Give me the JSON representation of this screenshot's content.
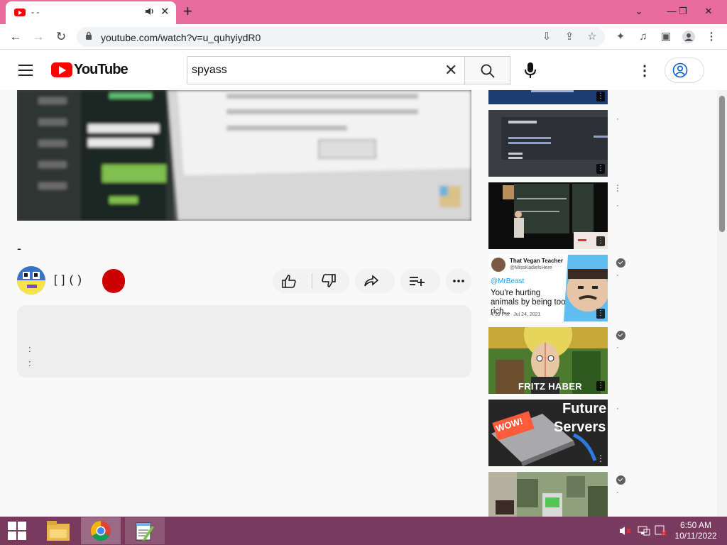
{
  "browser": {
    "tab_title": "- -",
    "url": "youtube.com/watch?v=u_quhyiydR0",
    "window_controls": [
      "chevron-down",
      "minimize",
      "restore",
      "close"
    ]
  },
  "youtube": {
    "logo_text": "YouTube",
    "search_value": "spyass",
    "video": {
      "title": "-",
      "channel_name": "[ ] ( )"
    },
    "description": {
      "line1": ":",
      "line2": ":"
    },
    "sidebar": [
      {
        "type": "thumb"
      },
      {
        "type": "thumb"
      },
      {
        "type": "thumb"
      },
      {
        "thumb_text": {
          "account_name": "That Vegan Teacher",
          "account_handle": "@MissKadielsHere",
          "mention": "@MrBeast",
          "tweet": "You're hurting animals by being too rich...",
          "timestamp": "4:39 PM · Jul 24, 2021"
        },
        "verified": true
      },
      {
        "thumb_text": "FRITZ HABER",
        "verified": true
      },
      {
        "thumb_text_1": "WOW!",
        "thumb_text_2": "Future",
        "thumb_text_3": "Servers"
      },
      {
        "verified": true
      }
    ]
  },
  "taskbar": {
    "time": "6:50 AM",
    "date": "10/11/2022"
  },
  "colors": {
    "tabstrip": "#e86b9b",
    "youtube_red": "#ff0000",
    "subscribe_red": "#cc0000",
    "taskbar": "#7a3a5e"
  }
}
